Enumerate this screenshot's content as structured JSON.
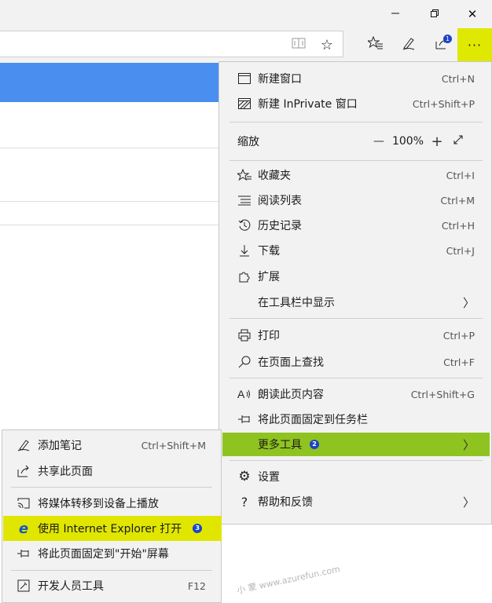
{
  "window_controls": {
    "maximize_glyph": "□",
    "close_glyph": "✕"
  },
  "toolbar": {
    "more_label": "···",
    "notification_count": "1"
  },
  "menu": {
    "new_window": {
      "label": "新建窗口",
      "shortcut": "Ctrl+N"
    },
    "new_inprivate": {
      "label": "新建 InPrivate 窗口",
      "shortcut": "Ctrl+Shift+P"
    },
    "zoom": {
      "label": "缩放",
      "minus": "—",
      "value": "100%",
      "plus": "+"
    },
    "favorites": {
      "label": "收藏夹",
      "shortcut": "Ctrl+I"
    },
    "reading_list": {
      "label": "阅读列表",
      "shortcut": "Ctrl+M"
    },
    "history": {
      "label": "历史记录",
      "shortcut": "Ctrl+H"
    },
    "downloads": {
      "label": "下载",
      "shortcut": "Ctrl+J"
    },
    "extensions": {
      "label": "扩展"
    },
    "show_in_toolbar": {
      "label": "在工具栏中显示"
    },
    "print": {
      "label": "打印",
      "shortcut": "Ctrl+P"
    },
    "find_on_page": {
      "label": "在页面上查找",
      "shortcut": "Ctrl+F"
    },
    "read_aloud": {
      "label": "朗读此页内容",
      "shortcut": "Ctrl+Shift+G"
    },
    "pin_taskbar": {
      "label": "将此页面固定到任务栏"
    },
    "more_tools": {
      "label": "更多工具",
      "badge": "2"
    },
    "settings": {
      "label": "设置"
    },
    "help": {
      "label": "帮助和反馈"
    }
  },
  "submenu": {
    "add_notes": {
      "label": "添加笔记",
      "shortcut": "Ctrl+Shift+M"
    },
    "share": {
      "label": "共享此页面"
    },
    "cast": {
      "label": "将媒体转移到设备上播放"
    },
    "open_ie": {
      "label": "使用 Internet Explorer 打开",
      "badge": "3"
    },
    "pin_start": {
      "label": "将此页面固定到\"开始\"屏幕"
    },
    "dev_tools": {
      "label": "开发人员工具",
      "shortcut": "F12"
    }
  },
  "watermark": "小 蒙 www.azurefun.com",
  "colors": {
    "highlight_yellow": "#e1e600",
    "highlight_green": "#8fc31f",
    "menu_bg": "#f2f2f2",
    "page_blue": "#4a8ff0",
    "badge_blue": "#1a44c8"
  }
}
